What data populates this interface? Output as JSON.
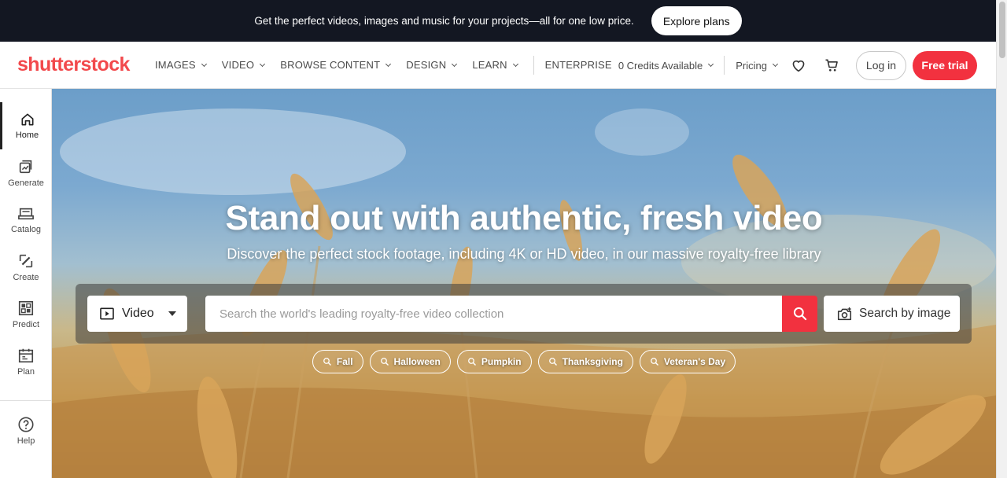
{
  "promo": {
    "text": "Get the perfect videos, images and music for your projects—all for one low price.",
    "button": "Explore plans"
  },
  "header": {
    "logo": "shutterstock",
    "nav": [
      {
        "label": "IMAGES"
      },
      {
        "label": "VIDEO"
      },
      {
        "label": "BROWSE CONTENT"
      },
      {
        "label": "DESIGN"
      },
      {
        "label": "LEARN"
      }
    ],
    "enterprise": "ENTERPRISE",
    "credits": "0 Credits Available",
    "pricing": "Pricing",
    "login": "Log in",
    "trial": "Free trial"
  },
  "sidebar": {
    "items": [
      {
        "label": "Home",
        "icon": "home-icon"
      },
      {
        "label": "Generate",
        "icon": "generate-icon"
      },
      {
        "label": "Catalog",
        "icon": "catalog-icon"
      },
      {
        "label": "Create",
        "icon": "create-icon"
      },
      {
        "label": "Predict",
        "icon": "predict-icon"
      },
      {
        "label": "Plan",
        "icon": "plan-icon"
      }
    ],
    "help": "Help"
  },
  "hero": {
    "title": "Stand out with authentic, fresh video",
    "subtitle": "Discover the perfect stock footage, including 4K or HD video, in our massive royalty-free library",
    "search": {
      "type_selected": "Video",
      "placeholder": "Search the world's leading royalty-free video collection",
      "value": "",
      "image_search": "Search by image"
    },
    "chips": [
      "Fall",
      "Halloween",
      "Pumpkin",
      "Thanksgiving",
      "Veteran's Day"
    ]
  },
  "colors": {
    "brand": "#f2494c",
    "accent": "#f2313f",
    "banner": "#131722"
  }
}
